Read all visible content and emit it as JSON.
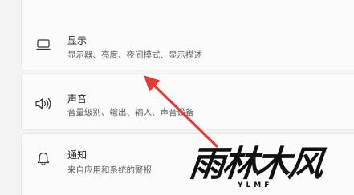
{
  "settings": {
    "items": [
      {
        "title": "显示",
        "subtitle": "显示器、亮度、夜间模式、显示描述",
        "icon": "monitor-icon"
      },
      {
        "title": "声音",
        "subtitle": "音量级别、输出、输入、声音设备",
        "icon": "speaker-icon"
      },
      {
        "title": "通知",
        "subtitle": "来自应用和系统的警报",
        "icon": "bell-icon"
      }
    ]
  },
  "annotation": {
    "arrow_color": "#e53935"
  },
  "watermark": {
    "text": "雨林木风",
    "subtext": "YLMF"
  }
}
